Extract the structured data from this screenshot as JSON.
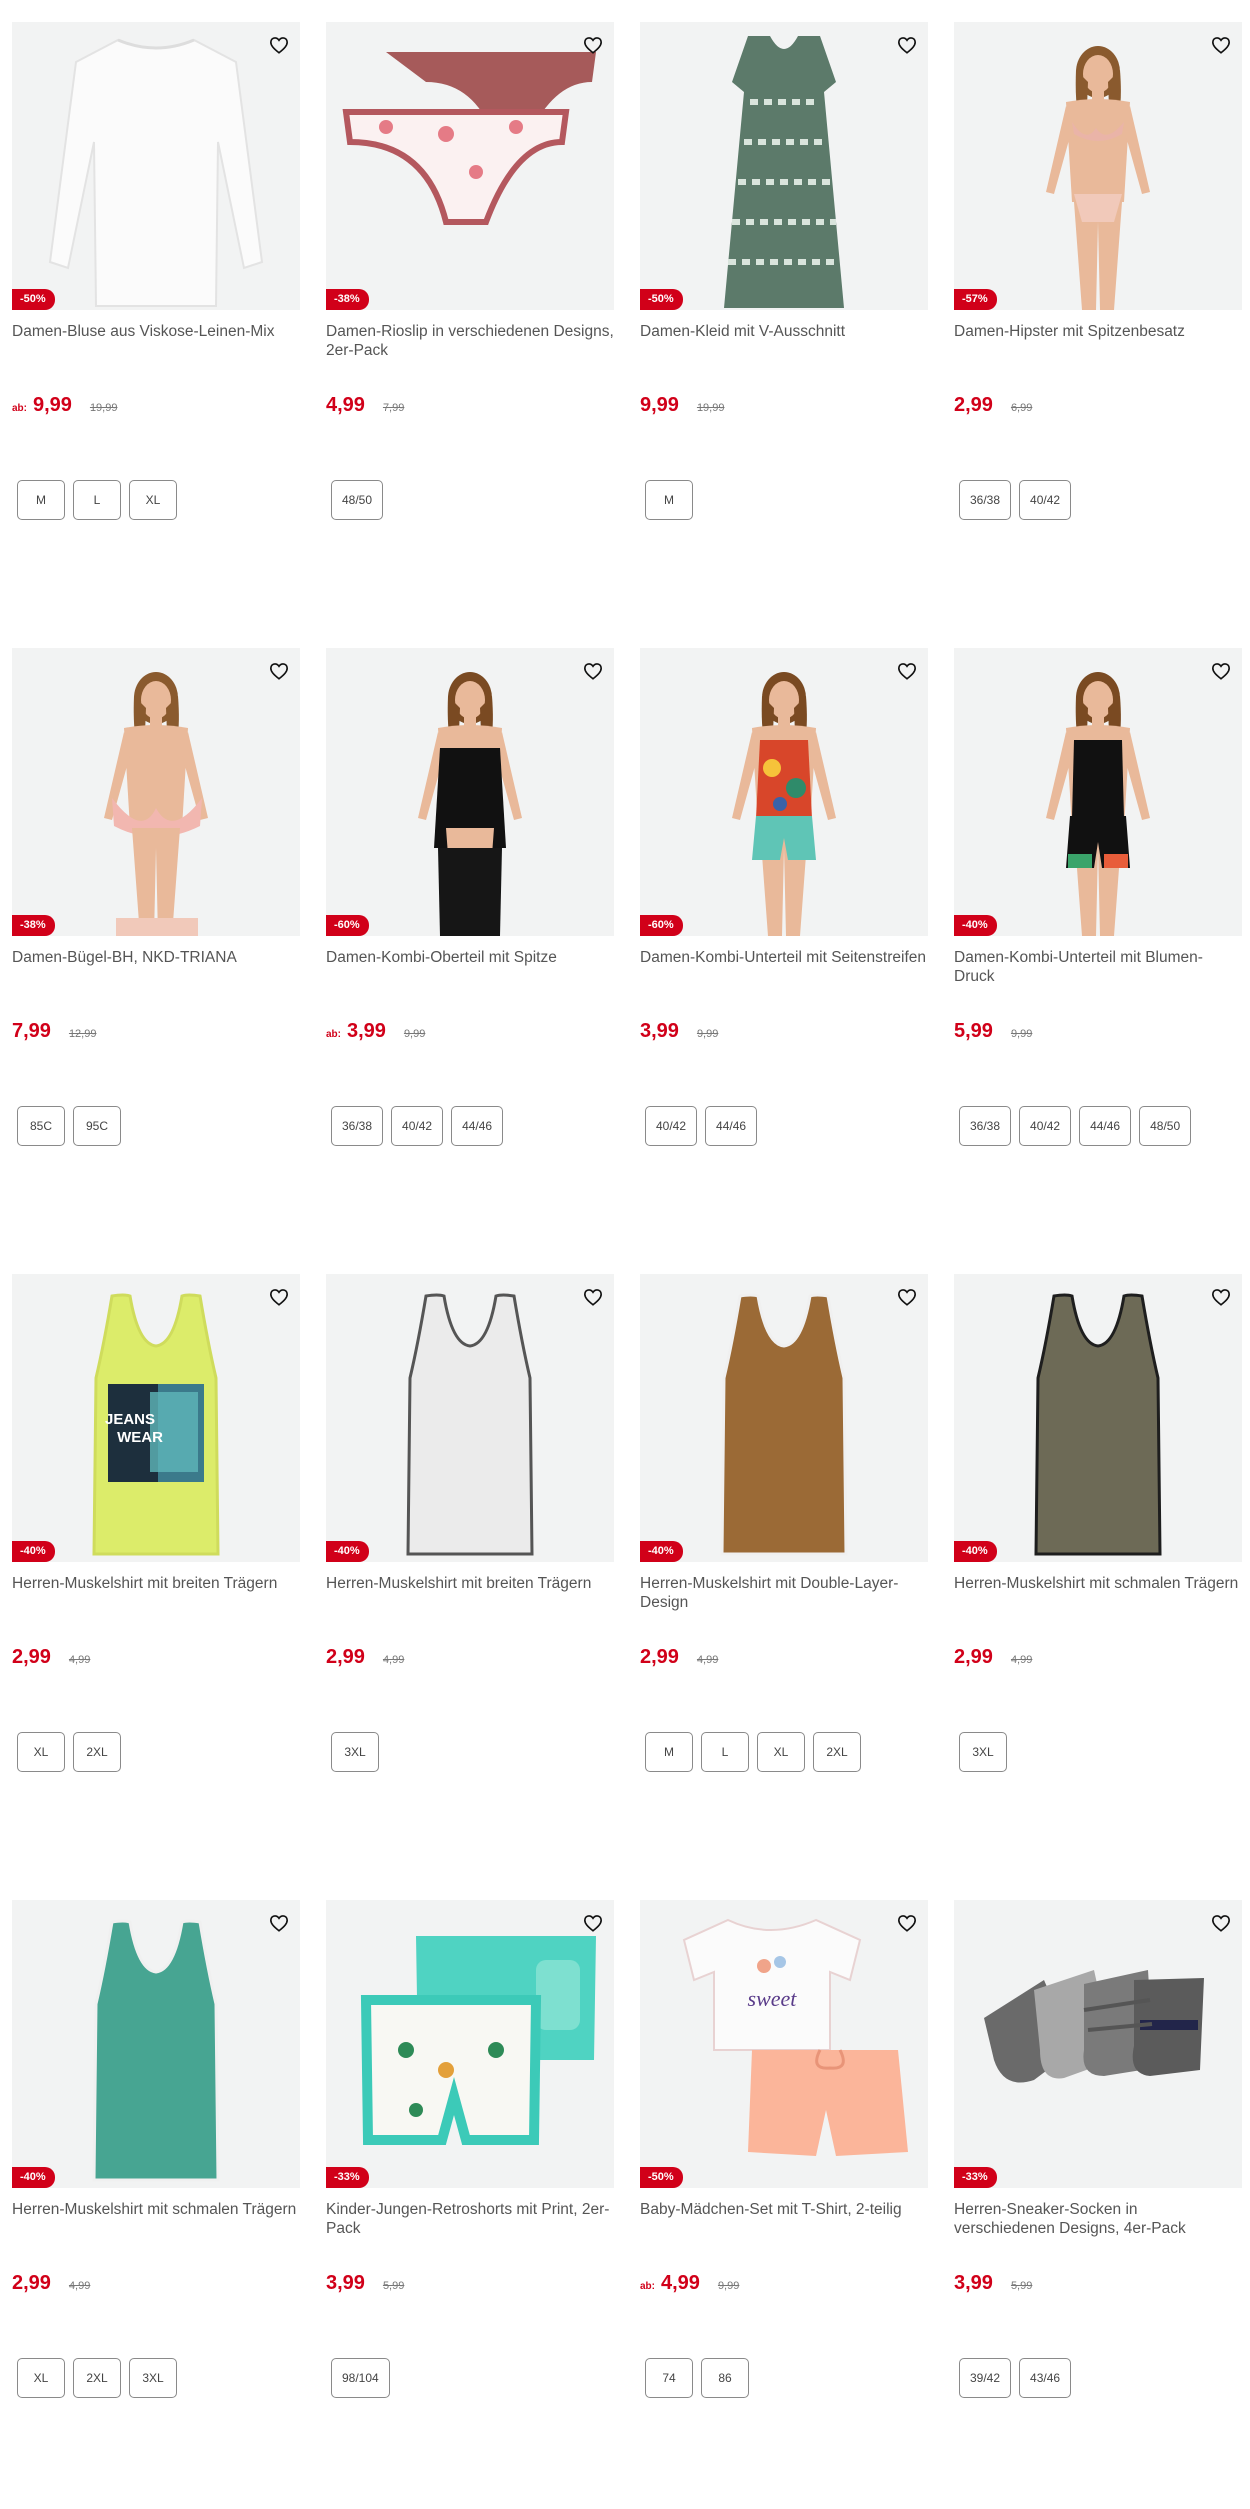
{
  "colors": {
    "accent": "#d10019",
    "image_bg": "#f2f3f3"
  },
  "icons": {
    "favorite": "heart-outline-icon"
  },
  "products": [
    {
      "title": "Damen-Bluse aus Viskose-Leinen-Mix",
      "badge": "-50%",
      "ab": "ab:",
      "price": "9,99",
      "old_price": "19,99",
      "sizes": [
        "M",
        "L",
        "XL"
      ],
      "image": "white-blouse"
    },
    {
      "title": "Damen-Rioslip in verschiedenen Designs, 2er-Pack",
      "badge": "-38%",
      "ab": "",
      "price": "4,99",
      "old_price": "7,99",
      "sizes": [
        "48/50"
      ],
      "image": "briefs-pack"
    },
    {
      "title": "Damen-Kleid mit V-Ausschnitt",
      "badge": "-50%",
      "ab": "",
      "price": "9,99",
      "old_price": "19,99",
      "sizes": [
        "M"
      ],
      "image": "green-dress"
    },
    {
      "title": "Damen-Hipster mit Spitzenbesatz",
      "badge": "-57%",
      "ab": "",
      "price": "2,99",
      "old_price": "6,99",
      "sizes": [
        "36/38",
        "40/42"
      ],
      "image": "model-lingerie"
    },
    {
      "title": "Damen-Bügel-BH, NKD-TRIANA",
      "badge": "-38%",
      "ab": "",
      "price": "7,99",
      "old_price": "12,99",
      "sizes": [
        "85C",
        "95C"
      ],
      "image": "model-bra"
    },
    {
      "title": "Damen-Kombi-Oberteil mit Spitze",
      "badge": "-60%",
      "ab": "ab:",
      "price": "3,99",
      "old_price": "9,99",
      "sizes": [
        "36/38",
        "40/42",
        "44/46"
      ],
      "image": "model-black-top"
    },
    {
      "title": "Damen-Kombi-Unterteil mit Seitenstreifen",
      "badge": "-60%",
      "ab": "",
      "price": "3,99",
      "old_price": "9,99",
      "sizes": [
        "40/42",
        "44/46"
      ],
      "image": "model-shorts-teal"
    },
    {
      "title": "Damen-Kombi-Unterteil mit Blumen-Druck",
      "badge": "-40%",
      "ab": "",
      "price": "5,99",
      "old_price": "9,99",
      "sizes": [
        "36/38",
        "40/42",
        "44/46",
        "48/50"
      ],
      "image": "model-shorts-black"
    },
    {
      "title": "Herren-Muskelshirt mit breiten Trägern",
      "badge": "-40%",
      "ab": "",
      "price": "2,99",
      "old_price": "4,99",
      "sizes": [
        "XL",
        "2XL"
      ],
      "image": "tank-lime",
      "print_text": "JEANS WEAR"
    },
    {
      "title": "Herren-Muskelshirt mit breiten Trägern",
      "badge": "-40%",
      "ab": "",
      "price": "2,99",
      "old_price": "4,99",
      "sizes": [
        "3XL"
      ],
      "image": "tank-grey"
    },
    {
      "title": "Herren-Muskelshirt mit Double-Layer-Design",
      "badge": "-40%",
      "ab": "",
      "price": "2,99",
      "old_price": "4,99",
      "sizes": [
        "M",
        "L",
        "XL",
        "2XL"
      ],
      "image": "tank-brown"
    },
    {
      "title": "Herren-Muskelshirt mit schmalen Trägern",
      "badge": "-40%",
      "ab": "",
      "price": "2,99",
      "old_price": "4,99",
      "sizes": [
        "3XL"
      ],
      "image": "tank-olive"
    },
    {
      "title": "Herren-Muskelshirt mit schmalen Trägern",
      "badge": "-40%",
      "ab": "",
      "price": "2,99",
      "old_price": "4,99",
      "sizes": [
        "XL",
        "2XL",
        "3XL"
      ],
      "image": "tank-teal"
    },
    {
      "title": "Kinder-Jungen-Retroshorts mit Print, 2er-Pack",
      "badge": "-33%",
      "ab": "",
      "price": "3,99",
      "old_price": "5,99",
      "sizes": [
        "98/104"
      ],
      "image": "kids-shorts"
    },
    {
      "title": "Baby-Mädchen-Set mit T-Shirt, 2-teilig",
      "badge": "-50%",
      "ab": "ab:",
      "price": "4,99",
      "old_price": "9,99",
      "sizes": [
        "74",
        "86"
      ],
      "image": "baby-set",
      "print_text": "sweet"
    },
    {
      "title": "Herren-Sneaker-Socken in verschiedenen Designs, 4er-Pack",
      "badge": "-33%",
      "ab": "",
      "price": "3,99",
      "old_price": "5,99",
      "sizes": [
        "39/42",
        "43/46"
      ],
      "image": "socks"
    }
  ]
}
